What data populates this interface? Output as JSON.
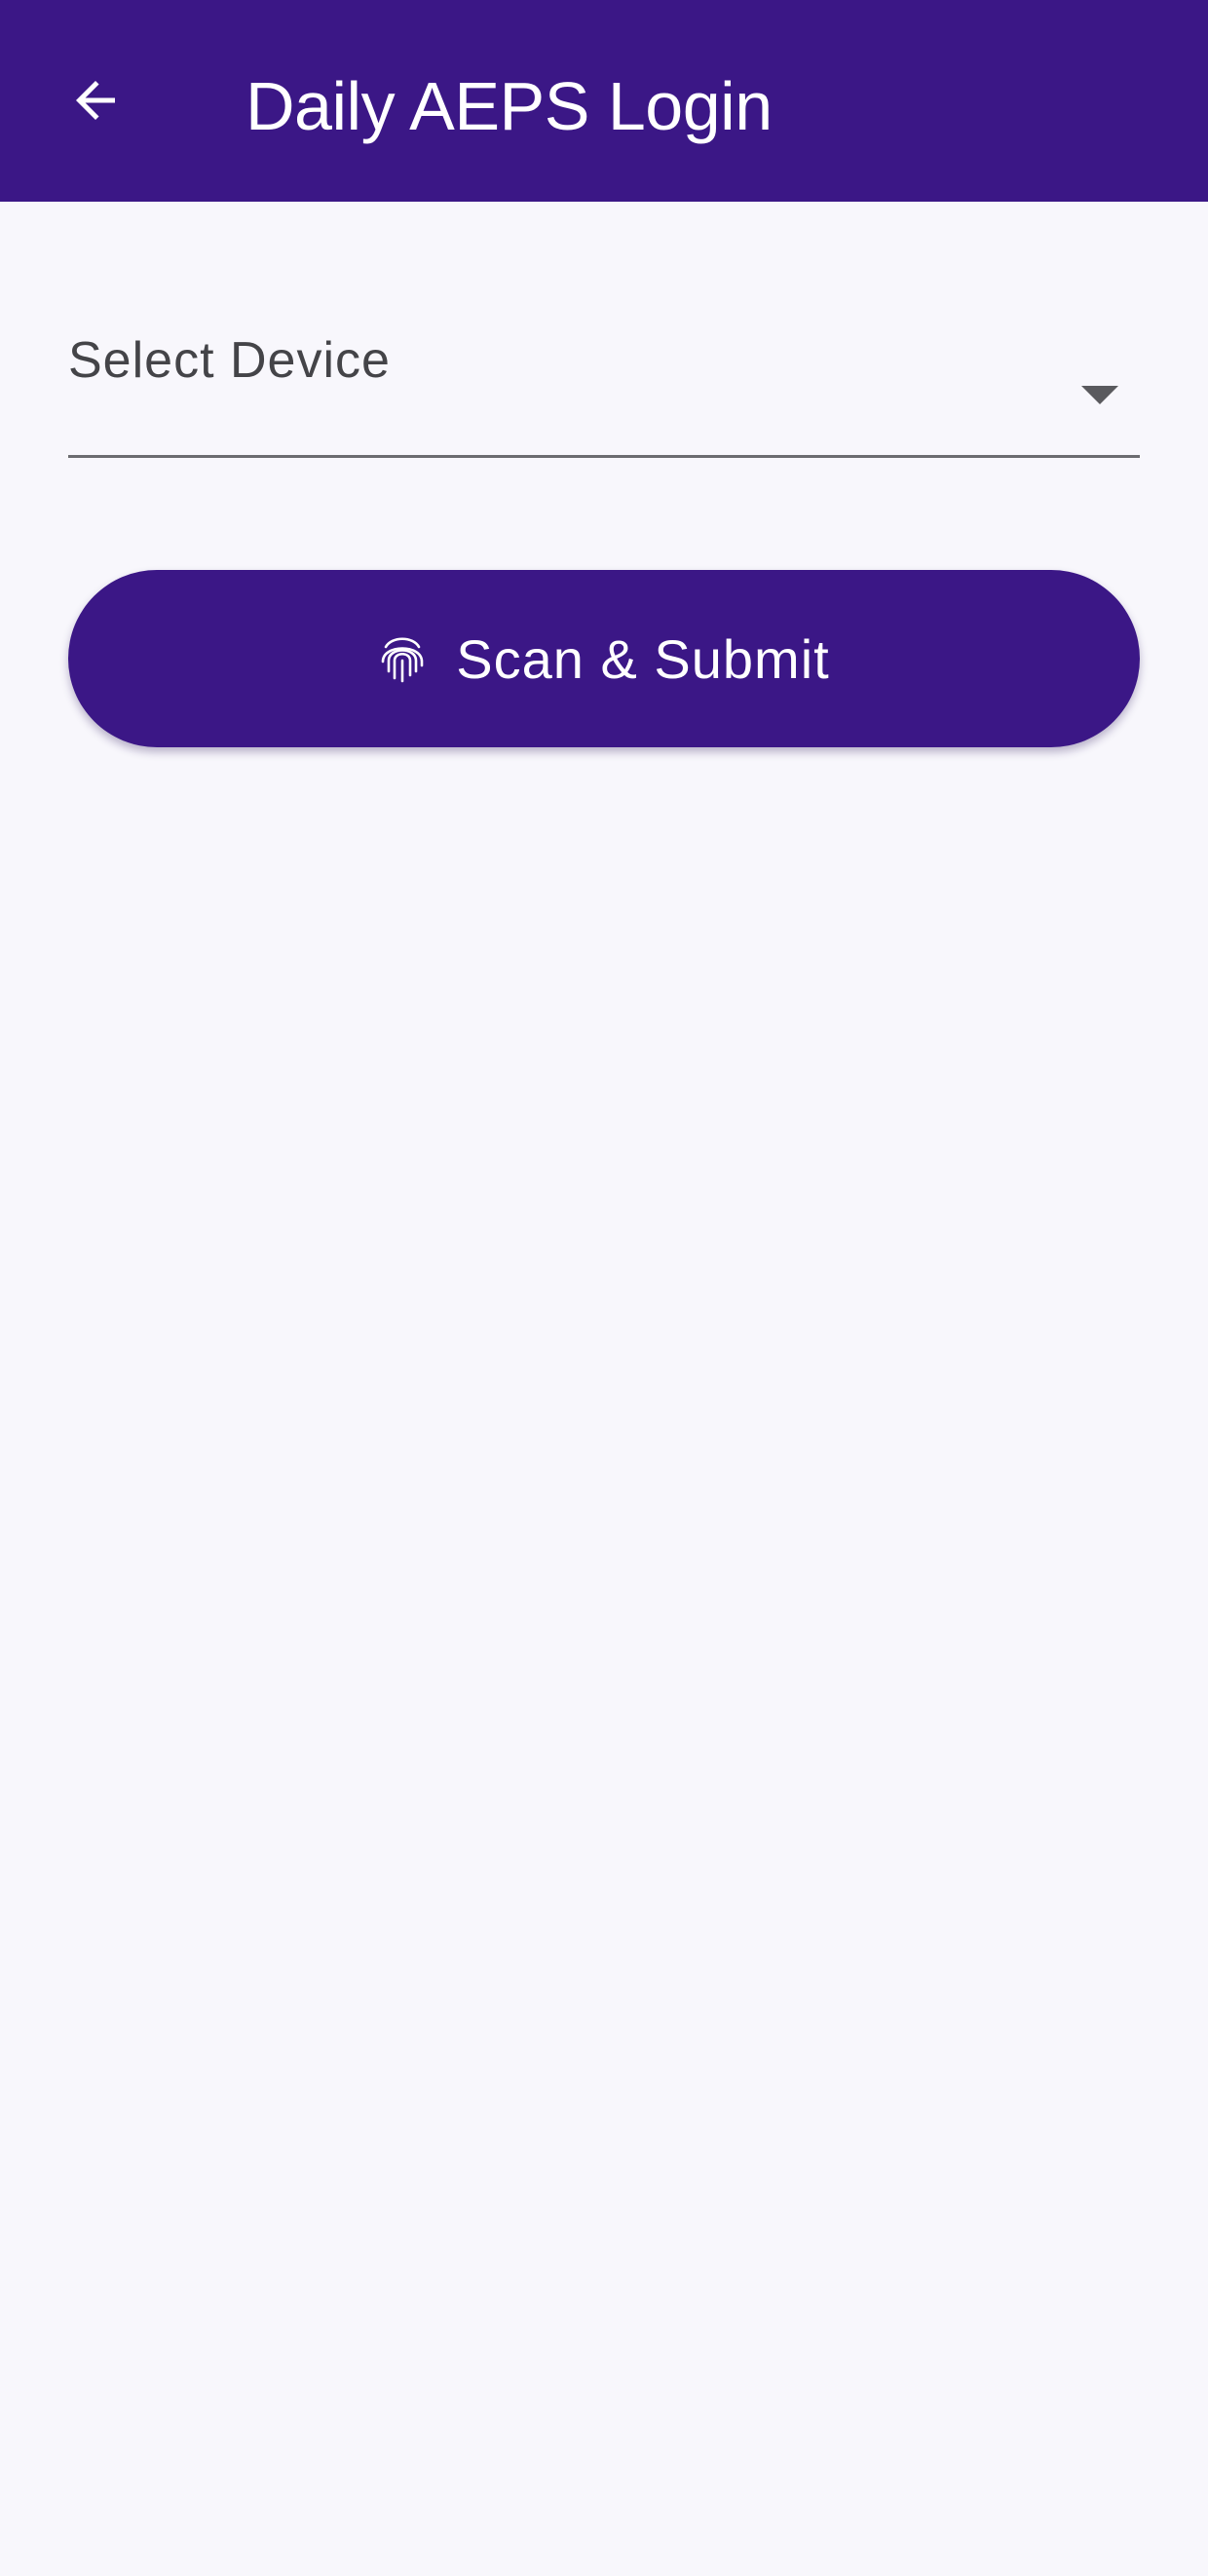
{
  "app_bar": {
    "title": "Daily AEPS Login",
    "back_icon": "arrow-back-icon",
    "background_color": "#3b1786"
  },
  "device_select": {
    "label": "Select Device",
    "caret_icon": "dropdown-caret-icon"
  },
  "scan_button": {
    "label": "Scan & Submit",
    "icon": "fingerprint-icon",
    "background_color": "#3b1786"
  }
}
